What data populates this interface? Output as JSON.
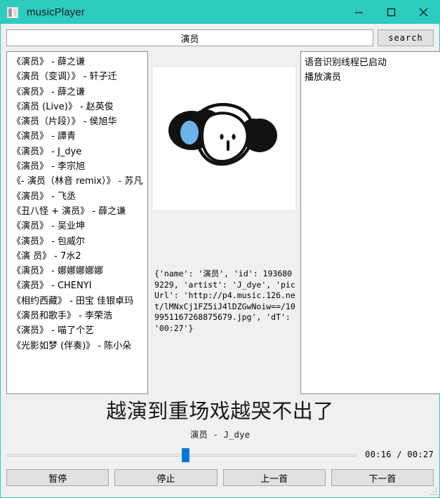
{
  "window": {
    "title": "musicPlayer",
    "icon": "app-window-icon",
    "titlebar_color": "#2ecbbf",
    "controls": {
      "minimize": "minimize-icon",
      "maximize": "maximize-icon",
      "close": "close-icon"
    }
  },
  "search": {
    "value": "演员",
    "placeholder": "",
    "button_label": "search"
  },
  "results": {
    "items": [
      "《演员》 - 薛之谦",
      "《演员（变调）》 - 轩子迁",
      "《演员》 - 薛之谦",
      "《演员 (Live)》 - 赵英俊",
      "《演员（片段）》 - 侯旭华",
      "《演员》 - 譚青",
      "《演员》 - J_dye",
      "《演员》 - 李宗旭",
      "《- 演员（林音 remix）》 - 苏凡",
      "《演员》 - 飞丞",
      "《丑八怪 + 演员》 - 薛之谦",
      "《演员》 - 吴业坤",
      "《演员》 - 包威尔",
      "《演 员》 - 7水2",
      "《演员》 - 娜娜娜娜娜",
      "《演员》 - CHENYI",
      "《相约西藏》 - 田宝 佳银卓玛",
      "《演员和歌手》 - 李荣浩",
      "《演员》 - 喵了个艺",
      "《光影如梦 (伴奏)》 - 陈小朵"
    ]
  },
  "cover": {
    "alt": "album-cover-panda-illustration",
    "bg": "#ffffff",
    "ink": "#111111",
    "accent": "#6cb3e8"
  },
  "metadata": {
    "text": "{'name': '演员', 'id': 1936809229, 'artist': 'J_dye', 'picUrl': 'http://p4.music.126.net/lMNxCj1FZ5iJ4lDZGwNoiw==/109951167268875679.jpg', 'dT': '00:27'}"
  },
  "log": {
    "lines": [
      "语音识别线程已启动",
      "播放演员"
    ]
  },
  "lyrics": {
    "current_line": "越演到重场戏越哭不出了",
    "now_playing": "演员 - J_dye"
  },
  "progress": {
    "elapsed": "00:16",
    "duration": "00:27",
    "time_label": "00:16 / 00:27",
    "percent": 51,
    "handle_color": "#0078d7"
  },
  "controls": {
    "pause": "暂停",
    "stop": "停止",
    "previous": "上一首",
    "next": "下一首"
  }
}
